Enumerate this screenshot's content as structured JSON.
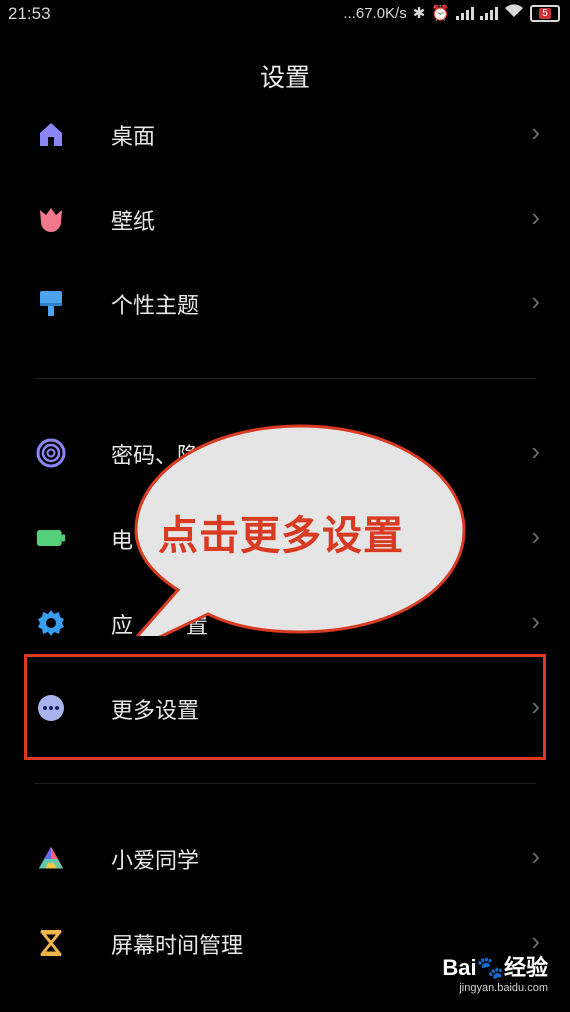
{
  "status": {
    "time": "21:53",
    "speed": "...67.0K/s",
    "battery": "5"
  },
  "title": "设置",
  "menu": {
    "desktop": "桌面",
    "wallpaper": "壁纸",
    "theme": "个性主题",
    "password": "密码、隐",
    "battery": "电",
    "apps": "应",
    "apps_tail": "置",
    "more": "更多设置",
    "xiaoai": "小爱同学",
    "screentime": "屏幕时间管理"
  },
  "annotation": "点击更多设置",
  "watermark": {
    "brand": "Bai🐾经验",
    "url": "jingyan.baidu.com"
  },
  "colors": {
    "accent_red": "#d83b22",
    "bubble_fill": "#e5e5e5"
  }
}
